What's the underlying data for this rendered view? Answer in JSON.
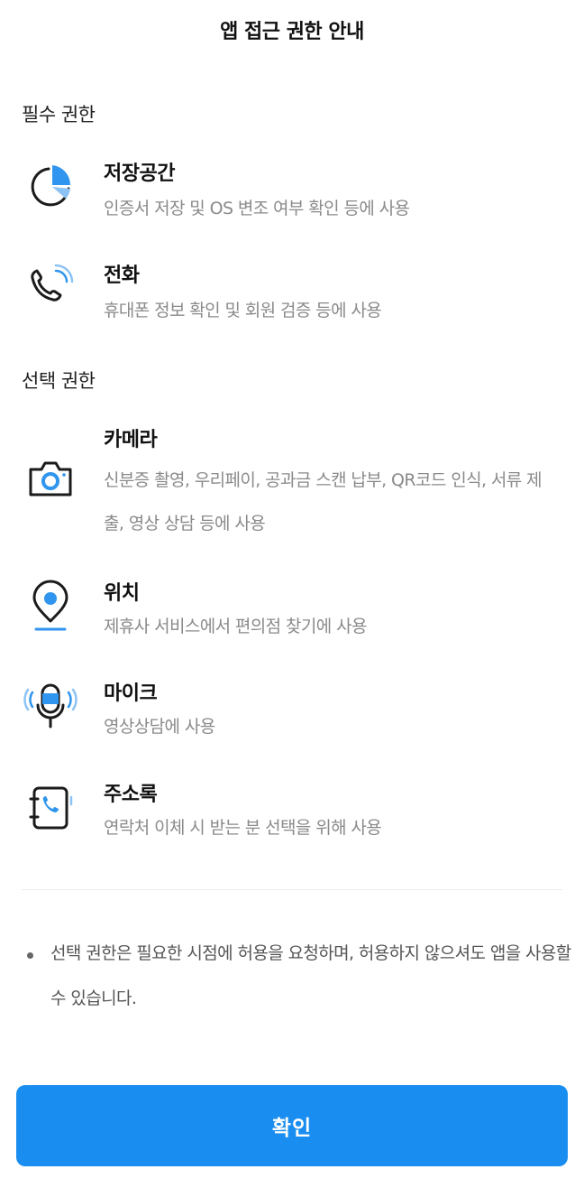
{
  "header": {
    "title": "앱 접근 권한 안내"
  },
  "required": {
    "heading": "필수 권한",
    "items": [
      {
        "icon": "storage-pie-icon",
        "name": "저장공간",
        "desc": "인증서 저장 및 OS 변조 여부 확인 등에 사용"
      },
      {
        "icon": "phone-icon",
        "name": "전화",
        "desc": "휴대폰 정보 확인 및 회원 검증 등에 사용"
      }
    ]
  },
  "optional": {
    "heading": "선택 권한",
    "items": [
      {
        "icon": "camera-icon",
        "name": "카메라",
        "desc": "신분증 촬영, 우리페이, 공과금 스캔 납부, QR코드 인식, 서류 제출, 영상 상담 등에 사용"
      },
      {
        "icon": "location-pin-icon",
        "name": "위치",
        "desc": "제휴사 서비스에서 편의점 찾기에 사용"
      },
      {
        "icon": "microphone-icon",
        "name": "마이크",
        "desc": "영상상담에 사용"
      },
      {
        "icon": "contacts-icon",
        "name": "주소록",
        "desc": "연락처 이체 시 받는 분 선택을 위해 사용"
      }
    ]
  },
  "note": {
    "text": "선택 권한은 필요한 시점에 허용을 요청하며, 허용하지 않으셔도 앱을 사용할 수 있습니다."
  },
  "footer": {
    "confirm_label": "확인"
  },
  "colors": {
    "accent": "#1a8ef0",
    "icon_stroke": "#1b1b1b",
    "icon_accent": "#2f95ee"
  }
}
